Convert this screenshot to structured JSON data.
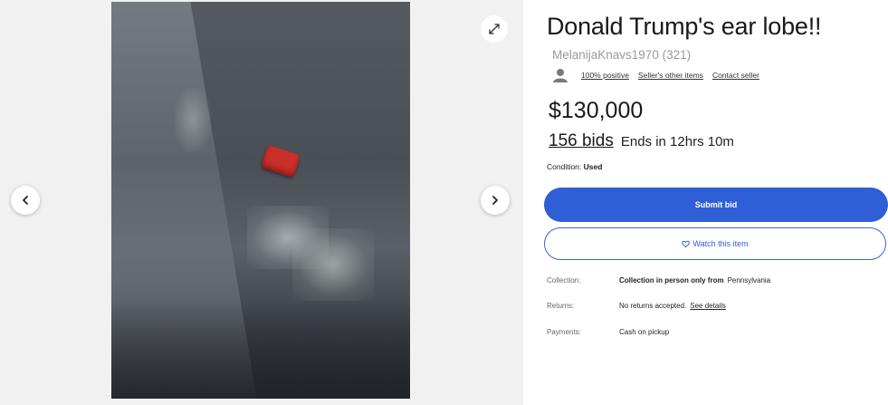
{
  "gallery": {
    "prev_icon": "chevron-left-icon",
    "next_icon": "chevron-right-icon",
    "expand_icon": "expand-icon"
  },
  "listing": {
    "title": "Donald Trump's ear lobe!!",
    "seller_name": "MelanijaKnavs1970 (321)",
    "seller_links": [
      "100% positive",
      "Seller's other items",
      "Contact seller"
    ],
    "price": "$130,000",
    "bids": "156 bids",
    "ends": "Ends in 12hrs 10m",
    "condition_label": "Condition:",
    "condition_value": "Used",
    "submit_label": "Submit bid",
    "watch_label": "Watch this item",
    "collection_label": "Collection:",
    "collection_value": "Collection in person only from",
    "collection_location": "Pennsylvania",
    "returns_label": "Returns:",
    "returns_value": "No returns accepted.",
    "returns_link": "See details",
    "payments_label": "Payments:",
    "payments_value": "Cash on pickup"
  },
  "colors": {
    "accent": "#2f5fd6",
    "item_red": "#c9302a"
  }
}
